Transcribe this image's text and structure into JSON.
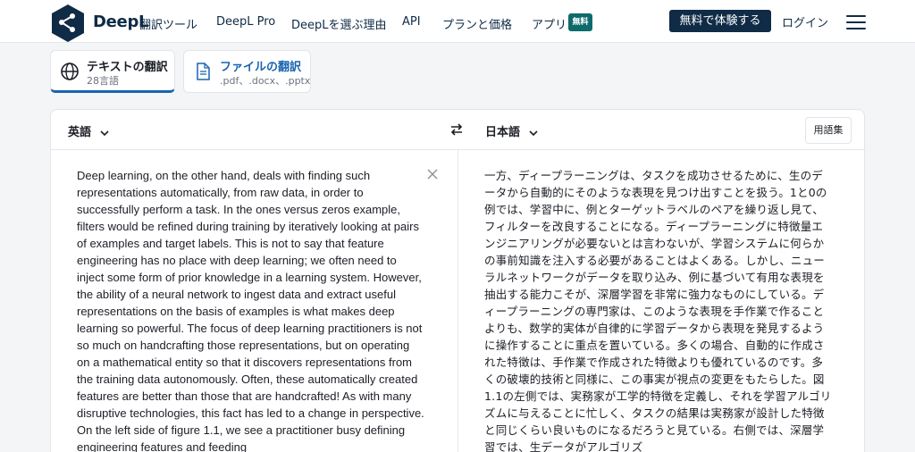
{
  "header": {
    "brand": "DeepL",
    "nav": [
      "翻訳ツール",
      "DeepL Pro",
      "DeepLを選ぶ理由",
      "API",
      "プランと価格",
      "アプリ"
    ],
    "apps_badge": "無料",
    "cta": "無料で体験する",
    "login": "ログイン"
  },
  "modes": [
    {
      "title": "テキストの翻訳",
      "subtitle": "28言語",
      "icon": "globe-icon"
    },
    {
      "title": "ファイルの翻訳",
      "subtitle": ".pdf、.docx、.pptx",
      "icon": "document-icon"
    }
  ],
  "translator": {
    "source_lang": "英語",
    "target_lang": "日本語",
    "glossary": "用語集",
    "source_text": "Deep learning, on the other hand, deals with finding such representations automatically, from raw data, in order to successfully perform a task. In the ones versus zeros example, filters would be refined during training by iteratively looking at pairs of examples and target labels. This is not to say that feature engineering has no place with deep learning; we often need to inject some form of prior knowledge in a learning system. However, the ability of a neural network to ingest data and extract useful representations on the basis of examples is what makes deep learning so powerful. The focus of deep learning practitioners is not so much on handcrafting those representations, but on operating on a mathematical entity so that it discovers representations from the training data autonomously. Often, these automatically created features are better than those that are handcrafted! As with many disruptive technologies, this fact has led to a change in perspective. On the left side of figure 1.1, we see a practitioner busy defining engineering features and feeding",
    "target_text": "一方、ディープラーニングは、タスクを成功させるために、生のデータから自動的にそのような表現を見つけ出すことを扱う。1と0の例では、学習中に、例とターゲットラベルのペアを繰り返し見て、フィルターを改良することになる。ディープラーニングに特徴量エンジニアリングが必要ないとは言わないが、学習システムに何らかの事前知識を注入する必要があることはよくある。しかし、ニューラルネットワークがデータを取り込み、例に基づいて有用な表現を抽出する能力こそが、深層学習を非常に強力なものにしている。ディープラーニングの専門家は、このような表現を手作業で作ることよりも、数学的実体が自律的に学習データから表現を発見するように操作することに重点を置いている。多くの場合、自動的に作成された特徴は、手作業で作成された特徴よりも優れているのです。多くの破壊的技術と同様に、この事実が視点の変更をもたらした。図1.1の左側では、実務家が工学的特徴を定義し、それを学習アルゴリズムに与えることに忙しく、タスクの結果は実務家が設計した特徴と同じくらい良いものになるだろうと見ている。右側では、深層学習では、生データがアルゴリズ"
  },
  "colors": {
    "brand_navy": "#0f2b46",
    "accent_blue": "#1a64b0",
    "badge_teal": "#0f6b6b"
  }
}
